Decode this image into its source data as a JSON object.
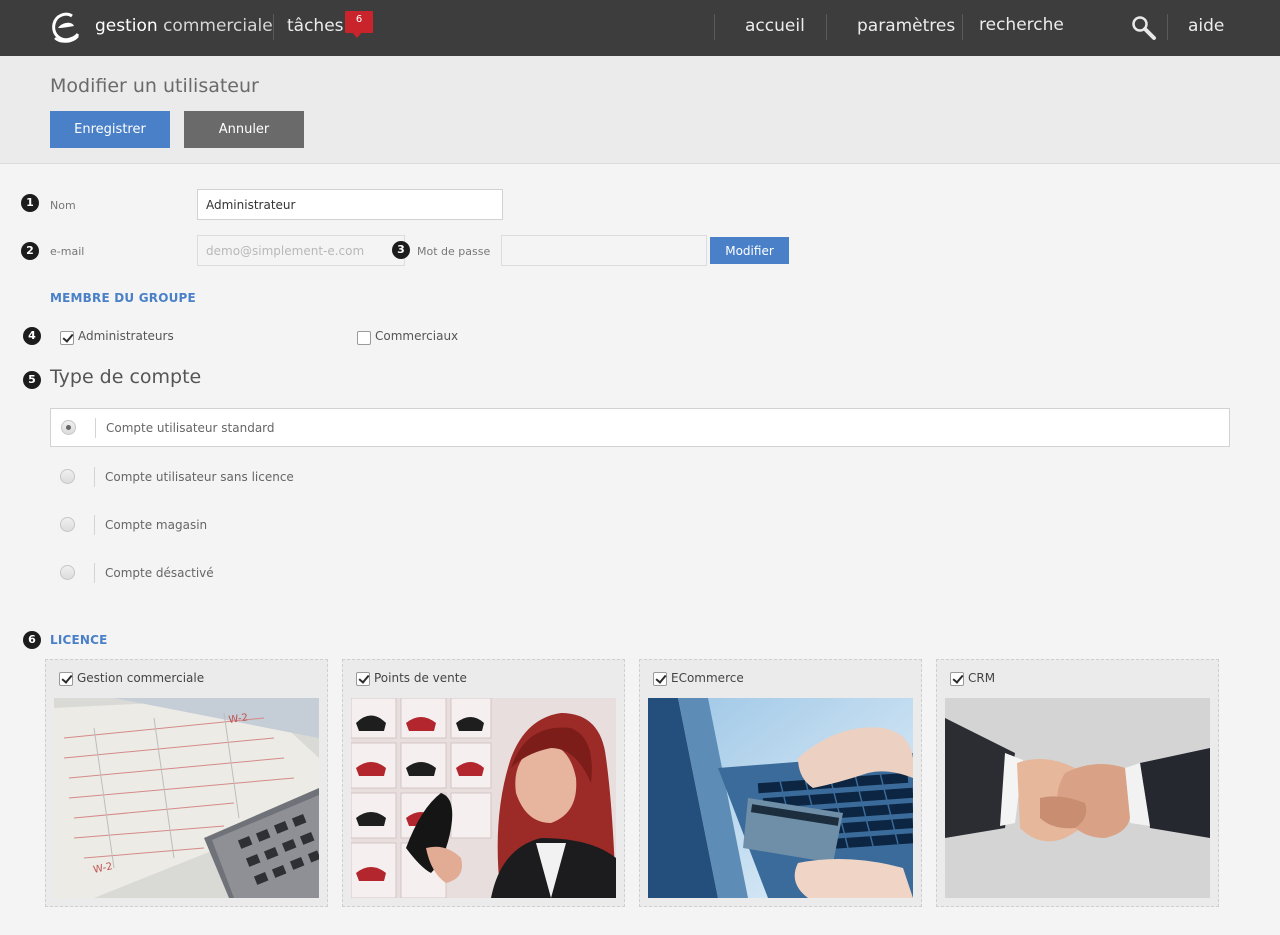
{
  "topbar": {
    "app_name_bold": "gestion",
    "app_name_light": " commerciale",
    "tasks_label": "tâches",
    "tasks_badge": "6",
    "nav": [
      "accueil",
      "paramètres",
      "recherche",
      "aide"
    ]
  },
  "page": {
    "title": "Modifier un utilisateur",
    "save_label": "Enregistrer",
    "cancel_label": "Annuler"
  },
  "form": {
    "markers": [
      "1",
      "2",
      "3",
      "4",
      "5",
      "6"
    ],
    "name_label": "Nom",
    "name_value": "Administrateur",
    "email_label": "e-mail",
    "email_placeholder": "demo@simplement-e.com",
    "password_label": "Mot de passe",
    "password_value": "",
    "modify_label": "Modifier"
  },
  "groups": {
    "heading": "MEMBRE DU GROUPE",
    "items": [
      {
        "label": "Administrateurs",
        "checked": true
      },
      {
        "label": "Commerciaux",
        "checked": false
      }
    ]
  },
  "account_type": {
    "heading": "Type de compte",
    "options": [
      {
        "label": "Compte utilisateur standard",
        "selected": true
      },
      {
        "label": "Compte utilisateur sans licence",
        "selected": false
      },
      {
        "label": "Compte magasin",
        "selected": false
      },
      {
        "label": "Compte désactivé",
        "selected": false
      }
    ]
  },
  "licence": {
    "heading": "LICENCE",
    "items": [
      {
        "label": "Gestion commerciale",
        "checked": true
      },
      {
        "label": "Points de vente",
        "checked": true
      },
      {
        "label": "ECommerce",
        "checked": true
      },
      {
        "label": "CRM",
        "checked": true
      }
    ]
  },
  "colors": {
    "accent": "#4a80c7",
    "topbar": "#3d3d3e",
    "badge": "#c9242b",
    "cancel": "#6a6a6a"
  },
  "icons": [
    "logo-e-icon",
    "speech-badge-icon",
    "search-magnifier-icon",
    "check-icon",
    "radio-dot-icon"
  ]
}
